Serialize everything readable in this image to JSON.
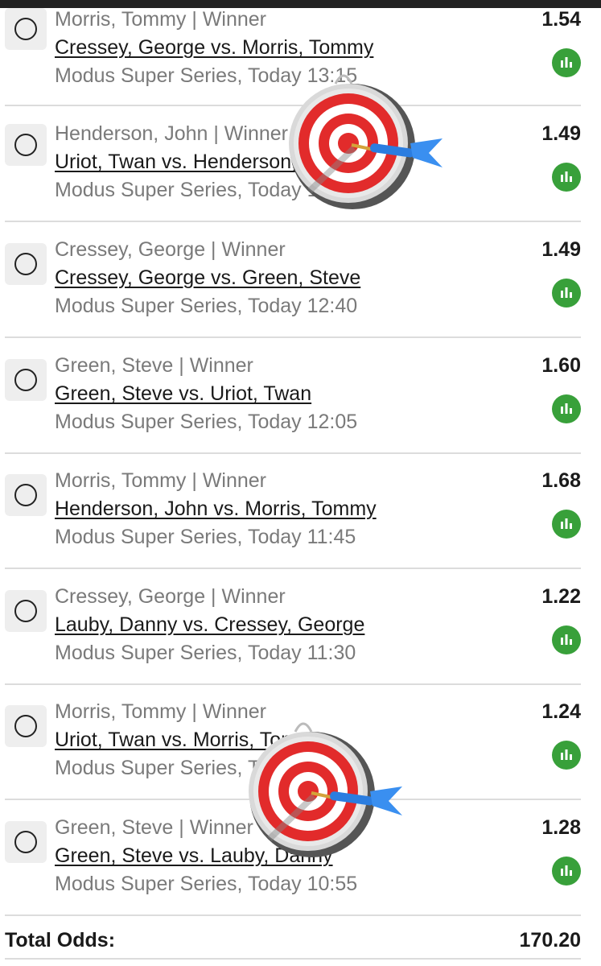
{
  "bets": [
    {
      "selection": "Morris, Tommy | Winner",
      "match": "Cressey, George vs. Morris, Tommy",
      "event": "Modus Super Series, Today 13:15",
      "odds": "1.54"
    },
    {
      "selection": "Henderson, John | Winner",
      "match": "Uriot, Twan vs. Henderson, John",
      "event": "Modus Super Series, Today 13:00",
      "odds": "1.49"
    },
    {
      "selection": "Cressey, George | Winner",
      "match": "Cressey, George vs. Green, Steve",
      "event": "Modus Super Series, Today 12:40",
      "odds": "1.49"
    },
    {
      "selection": "Green, Steve | Winner",
      "match": "Green, Steve vs. Uriot, Twan",
      "event": "Modus Super Series, Today 12:05",
      "odds": "1.60"
    },
    {
      "selection": "Morris, Tommy | Winner",
      "match": "Henderson, John vs. Morris, Tommy",
      "event": "Modus Super Series, Today 11:45",
      "odds": "1.68"
    },
    {
      "selection": "Cressey, George | Winner",
      "match": "Lauby, Danny vs. Cressey, George",
      "event": "Modus Super Series, Today 11:30",
      "odds": "1.22"
    },
    {
      "selection": "Morris, Tommy | Winner",
      "match": "Uriot, Twan vs. Morris, Tommy",
      "event": "Modus Super Series, Today 11:10",
      "odds": "1.24"
    },
    {
      "selection": "Green, Steve | Winner",
      "match": "Green, Steve vs. Lauby, Danny",
      "event": "Modus Super Series, Today 10:55",
      "odds": "1.28"
    }
  ],
  "total": {
    "label": "Total Odds:",
    "value": "170.20"
  },
  "icons": {
    "radio": "radio-unchecked-icon",
    "stats": "bar-chart-icon",
    "sticker": "dartboard-emoji"
  },
  "colors": {
    "stats_button": "#38a03a",
    "divider": "#dcdcdc",
    "muted_text": "#7a7a7a"
  }
}
